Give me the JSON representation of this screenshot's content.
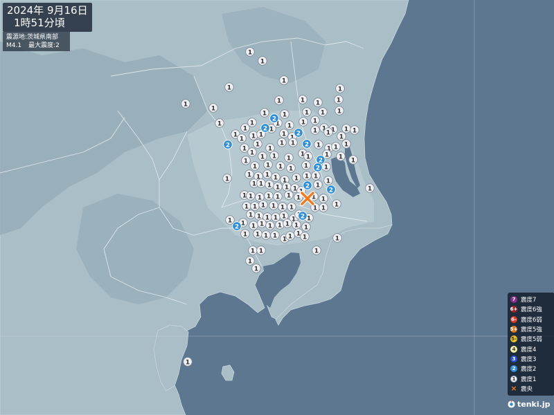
{
  "header": {
    "date": "2024年  9月16日",
    "time": "1時51分頃"
  },
  "info": {
    "epicenter_label": "震源地:",
    "epicenter": "茨城県南部",
    "magnitude": "M4.1",
    "max_intensity_label": "最大震度:",
    "max_intensity": "2"
  },
  "legend": [
    {
      "symbol": "7",
      "label": "震度7",
      "color": "#8b2c8f",
      "text_color": "#ffffff"
    },
    {
      "symbol": "6+",
      "label": "震度6強",
      "color": "#a0282c",
      "text_color": "#ffffff"
    },
    {
      "symbol": "6-",
      "label": "震度6弱",
      "color": "#d73a2a",
      "text_color": "#ffffff"
    },
    {
      "symbol": "5+",
      "label": "震度5強",
      "color": "#e07a1e",
      "text_color": "#ffffff"
    },
    {
      "symbol": "5-",
      "label": "震度5弱",
      "color": "#e8c22a",
      "text_color": "#333333"
    },
    {
      "symbol": "4",
      "label": "震度4",
      "color": "#f4efa0",
      "text_color": "#333333"
    },
    {
      "symbol": "3",
      "label": "震度3",
      "color": "#2a52c8",
      "text_color": "#ffffff"
    },
    {
      "symbol": "2",
      "label": "震度2",
      "color": "#2f8fd6",
      "text_color": "#ffffff"
    },
    {
      "symbol": "1",
      "label": "震度1",
      "color": "#eef0f4",
      "text_color": "#333333"
    },
    {
      "symbol": "×",
      "label": "震央",
      "color": "#f07a20",
      "text_color": "#ffffff"
    }
  ],
  "brand": "tenki.jp",
  "colors": {
    "sea": "#5d7791",
    "land": "#a9bec7",
    "land_shade": "#93aab5",
    "intensity_1": "#eef0f4",
    "intensity_2": "#2f8fd6",
    "epicenter": "#f07a20"
  },
  "map": {
    "epicenter_icon": "epicenter-x-icon",
    "intensity_2_stations": 14,
    "intensity_1_note": "多数"
  }
}
